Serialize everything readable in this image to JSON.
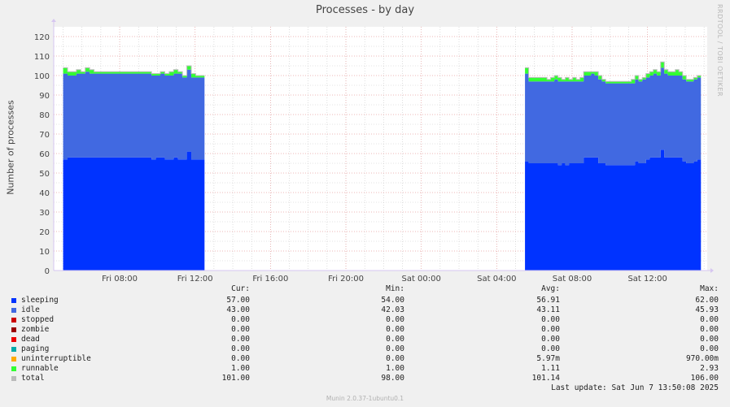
{
  "side_note": "RRDTOOL / TOBI OETIKER",
  "colors": {
    "background": "#f0f0f0",
    "plot_background": "#ffffff",
    "major_grid": "#e8a0a0",
    "minor_grid": "#c8c8c8",
    "axis": "#d6c6f0",
    "sleeping": "#0033ff",
    "idle": "#4169e1",
    "runnable": "#33ff33",
    "total": "#bbbbbb"
  },
  "chart_data": {
    "type": "area",
    "stacked": true,
    "title": "Processes - by day",
    "ylabel": "Number of processes",
    "xlabel": "",
    "ylim": [
      0,
      125
    ],
    "yticks": [
      0,
      10,
      20,
      30,
      40,
      50,
      60,
      70,
      80,
      90,
      100,
      110,
      120
    ],
    "xlim": [
      "Fri 04:30",
      "Sat 15:10"
    ],
    "xticks": [
      "Fri 08:00",
      "Fri 12:00",
      "Fri 16:00",
      "Fri 20:00",
      "Sat 00:00",
      "Sat 04:00",
      "Sat 08:00",
      "Sat 12:00"
    ],
    "grid": true,
    "segments": [
      {
        "x_start": "Fri 05:00",
        "x_end": "Fri 12:30",
        "sleeping": [
          57,
          58,
          58,
          58,
          58,
          58,
          58,
          58,
          58,
          58,
          58,
          58,
          58,
          58,
          58,
          58,
          58,
          58,
          58,
          58,
          57,
          58,
          58,
          57,
          57,
          58,
          57,
          57,
          61,
          57,
          57,
          57
        ],
        "idle": [
          44,
          42,
          42,
          43,
          43,
          44,
          43,
          43,
          43,
          43,
          43,
          43,
          43,
          43,
          43,
          43,
          43,
          43,
          43,
          43,
          43,
          42,
          43,
          43,
          43,
          43,
          44,
          42,
          42,
          42,
          42,
          42
        ],
        "runnable": [
          3,
          2,
          2,
          2,
          1,
          2,
          2,
          1,
          1,
          1,
          1,
          1,
          1,
          1,
          1,
          1,
          1,
          1,
          1,
          1,
          1,
          1,
          1,
          1,
          2,
          2,
          1,
          1,
          2,
          2,
          1,
          1
        ]
      },
      {
        "x_start": "Sat 05:30",
        "x_end": "Sat 14:50",
        "sleeping": [
          56,
          55,
          55,
          55,
          55,
          55,
          55,
          55,
          55,
          54,
          55,
          54,
          55,
          55,
          55,
          55,
          58,
          58,
          58,
          58,
          55,
          55,
          54,
          54,
          54,
          54,
          54,
          54,
          54,
          54,
          56,
          55,
          55,
          57,
          58,
          58,
          58,
          62,
          58,
          58,
          58,
          58,
          58,
          56,
          55,
          55,
          56,
          57
        ],
        "idle": [
          45,
          42,
          42,
          42,
          42,
          42,
          42,
          42,
          43,
          43,
          42,
          43,
          42,
          42,
          42,
          42,
          42,
          42,
          43,
          42,
          43,
          42,
          42,
          42,
          42,
          42,
          42,
          42,
          42,
          42,
          42,
          42,
          43,
          42,
          42,
          43,
          42,
          42,
          43,
          42,
          42,
          42,
          42,
          42,
          42,
          42,
          42,
          42
        ],
        "runnable": [
          3,
          2,
          2,
          2,
          2,
          2,
          1,
          2,
          2,
          2,
          1,
          2,
          1,
          2,
          1,
          2,
          2,
          2,
          1,
          2,
          2,
          1,
          1,
          1,
          1,
          1,
          1,
          1,
          1,
          2,
          2,
          1,
          1,
          2,
          2,
          2,
          2,
          3,
          2,
          2,
          2,
          3,
          2,
          2,
          1,
          1,
          1,
          1
        ]
      }
    ]
  },
  "legend": {
    "headers": {
      "cur": "Cur:",
      "min": "Min:",
      "avg": "Avg:",
      "max": "Max:"
    },
    "rows": [
      {
        "name": "sleeping",
        "color": "#0033ff",
        "cur": "57.00",
        "min": "54.00",
        "avg": "56.91",
        "max": "62.00"
      },
      {
        "name": "idle",
        "color": "#4169e1",
        "cur": "43.00",
        "min": "42.03",
        "avg": "43.11",
        "max": "45.93"
      },
      {
        "name": "stopped",
        "color": "#cc0000",
        "cur": "0.00",
        "min": "0.00",
        "avg": "0.00",
        "max": "0.00"
      },
      {
        "name": "zombie",
        "color": "#990000",
        "cur": "0.00",
        "min": "0.00",
        "avg": "0.00",
        "max": "0.00"
      },
      {
        "name": "dead",
        "color": "#ee0000",
        "cur": "0.00",
        "min": "0.00",
        "avg": "0.00",
        "max": "0.00"
      },
      {
        "name": "paging",
        "color": "#00aaaa",
        "cur": "0.00",
        "min": "0.00",
        "avg": "0.00",
        "max": "0.00"
      },
      {
        "name": "uninterruptible",
        "color": "#ffaa00",
        "cur": "0.00",
        "min": "0.00",
        "avg": "5.97m",
        "max": "970.00m"
      },
      {
        "name": "runnable",
        "color": "#33ff33",
        "cur": "1.00",
        "min": "1.00",
        "avg": "1.11",
        "max": "2.93"
      },
      {
        "name": "total",
        "color": "#bbbbbb",
        "cur": "101.00",
        "min": "98.00",
        "avg": "101.14",
        "max": "106.00"
      }
    ]
  },
  "last_update": "Last update: Sat Jun  7 13:50:08 2025",
  "footer": "Munin 2.0.37-1ubuntu0.1"
}
